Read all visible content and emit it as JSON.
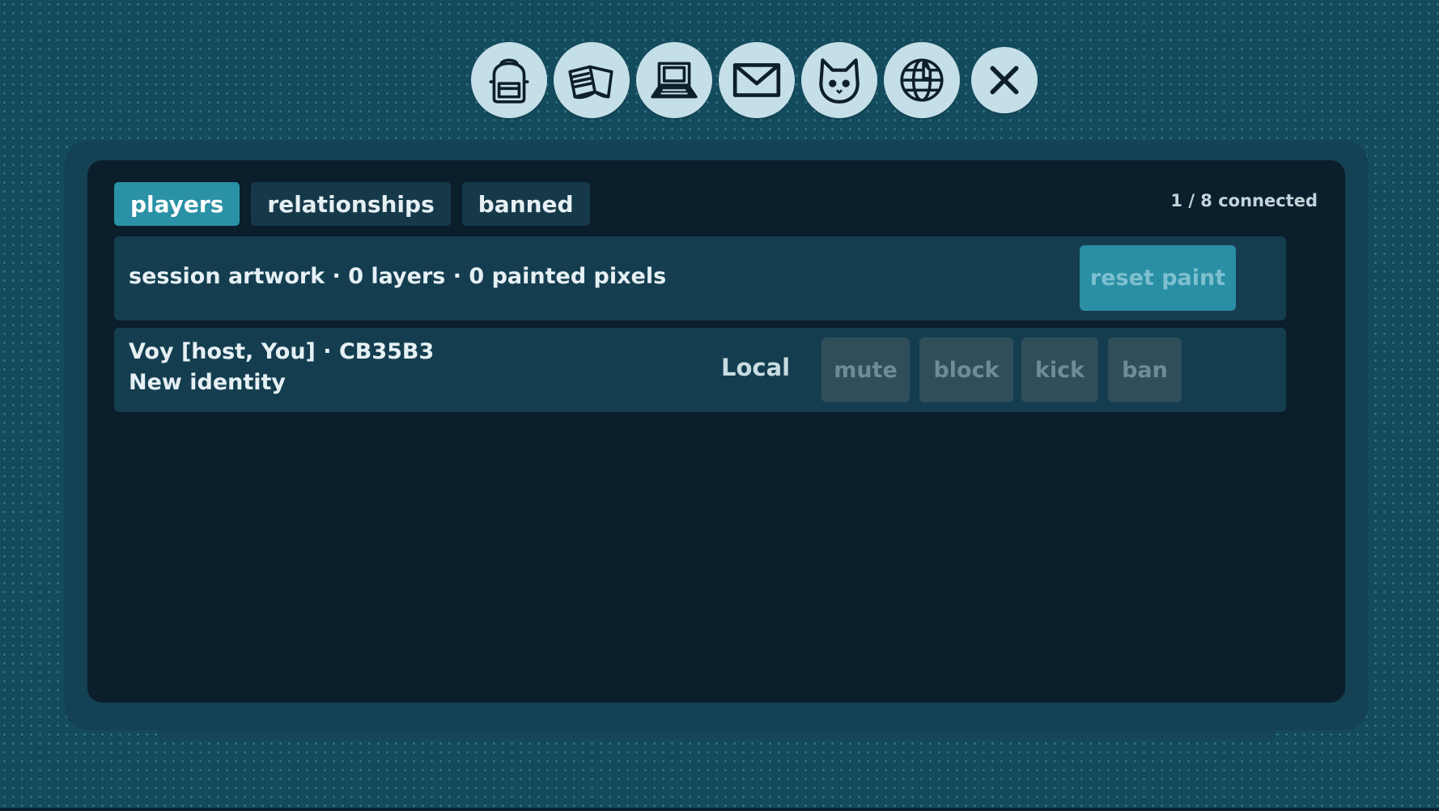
{
  "toolbar": {
    "icons": [
      "backpack-icon",
      "book-icon",
      "laptop-icon",
      "mail-icon",
      "cat-icon",
      "globe-icon",
      "close-icon"
    ]
  },
  "tabs": [
    {
      "label": "players",
      "active": true
    },
    {
      "label": "relationships",
      "active": false
    },
    {
      "label": "banned",
      "active": false
    }
  ],
  "status": {
    "connected": "1 / 8 connected"
  },
  "artwork": {
    "summary": "session artwork · 0 layers · 0 painted pixels",
    "reset_label": "reset paint"
  },
  "player": {
    "line1": "Voy  [host, You] · CB35B3",
    "line2": "New identity",
    "location": "Local",
    "actions": {
      "mute": "mute",
      "block": "block",
      "kick": "kick",
      "ban": "ban"
    }
  },
  "colors": {
    "background": "#134a5c",
    "panel": "#0b1e2b",
    "accent": "#2a91a6",
    "disabled_button": "#304e5a"
  }
}
